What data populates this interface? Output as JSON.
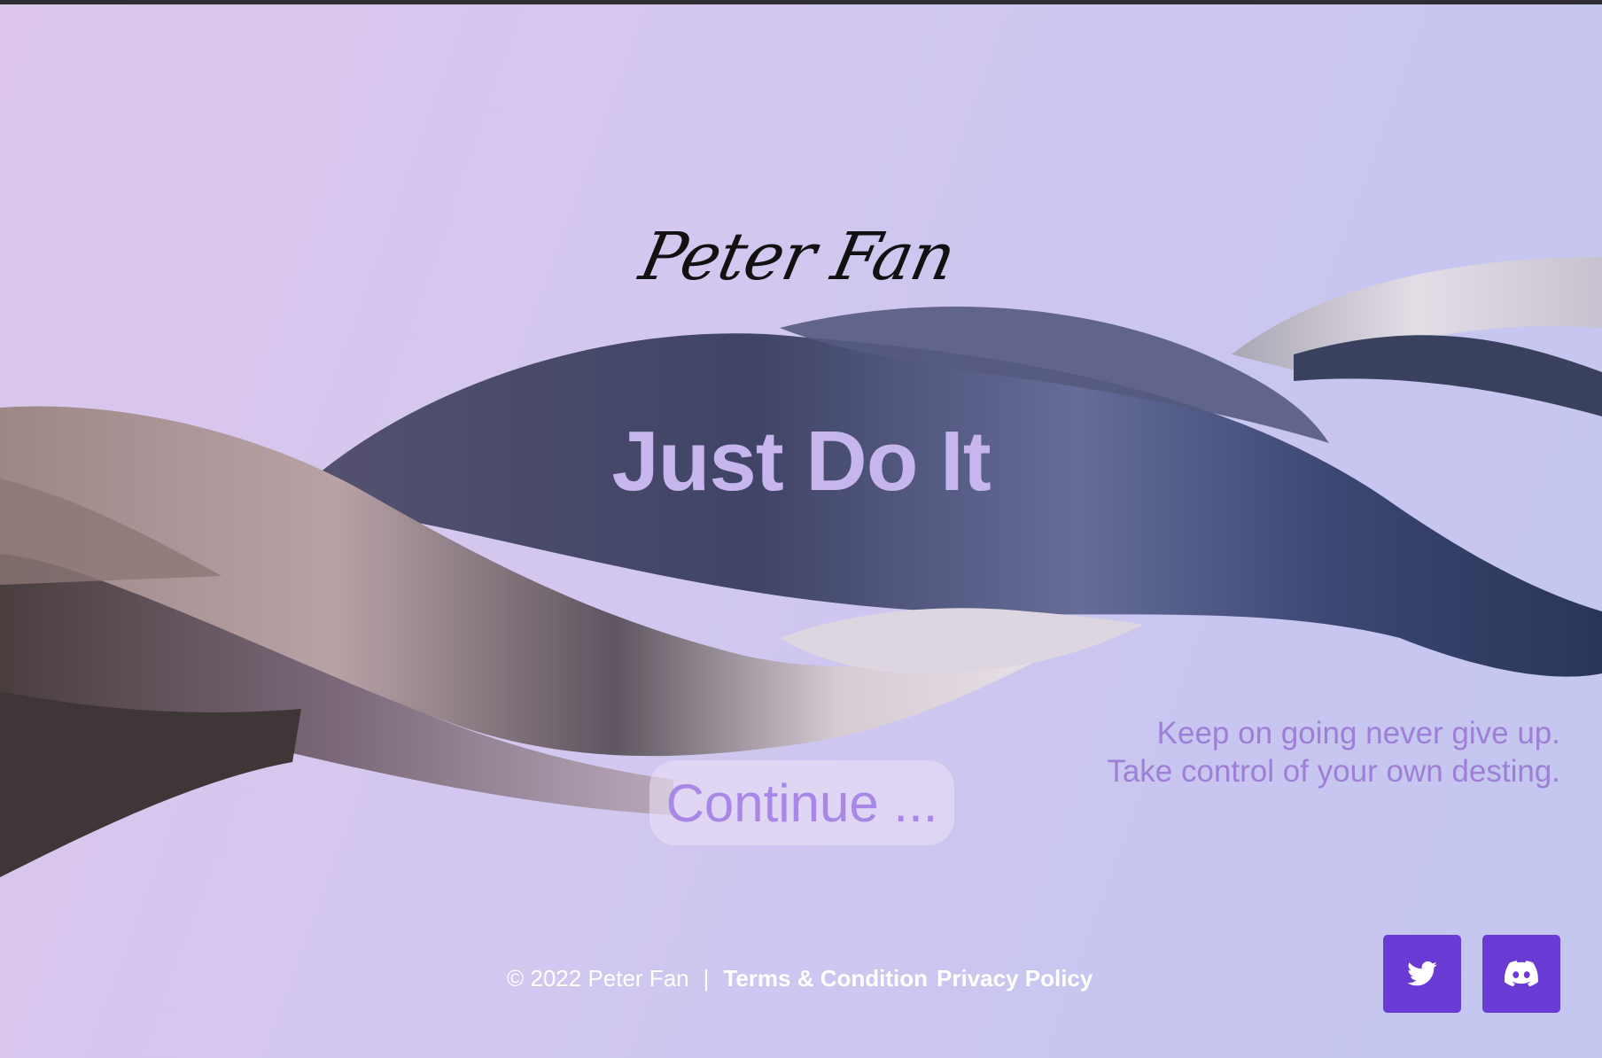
{
  "brand": {
    "signature": "Peter Fan"
  },
  "hero": {
    "title": "Just Do It",
    "tagline_line1": "Keep on going never give up.",
    "tagline_line2": "Take control of your own desting.",
    "continue_label": "Continue ..."
  },
  "footer": {
    "copyright": "© 2022 Peter Fan",
    "separator": "|",
    "terms_label": "Terms & Condition",
    "privacy_label": "Privacy Policy"
  },
  "social": [
    {
      "icon": "twitter-icon",
      "color": "#6a3bd4"
    },
    {
      "icon": "discord-icon",
      "color": "#6a3bd4"
    }
  ],
  "colors": {
    "accent": "#6a3bd4",
    "title": "#c7b5ee",
    "tagline": "#9d7fd6",
    "button_text": "#a888e6"
  }
}
